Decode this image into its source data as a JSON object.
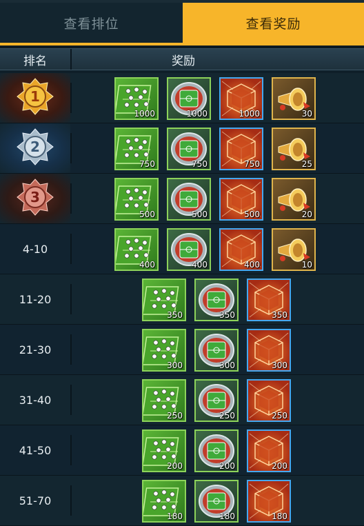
{
  "tabs": {
    "rank_tab": "查看排位",
    "reward_tab": "查看奖励"
  },
  "header": {
    "rank": "排名",
    "reward": "奖励"
  },
  "rows": [
    {
      "rank": "1",
      "rewards": [
        {
          "type": "tactic",
          "qty": "1000"
        },
        {
          "type": "stadium",
          "qty": "1000"
        },
        {
          "type": "cube",
          "qty": "1000"
        },
        {
          "type": "horn",
          "qty": "30"
        }
      ]
    },
    {
      "rank": "2",
      "rewards": [
        {
          "type": "tactic",
          "qty": "750"
        },
        {
          "type": "stadium",
          "qty": "750"
        },
        {
          "type": "cube",
          "qty": "750"
        },
        {
          "type": "horn",
          "qty": "25"
        }
      ]
    },
    {
      "rank": "3",
      "rewards": [
        {
          "type": "tactic",
          "qty": "500"
        },
        {
          "type": "stadium",
          "qty": "500"
        },
        {
          "type": "cube",
          "qty": "500"
        },
        {
          "type": "horn",
          "qty": "20"
        }
      ]
    },
    {
      "rank": "4-10",
      "rewards": [
        {
          "type": "tactic",
          "qty": "400"
        },
        {
          "type": "stadium",
          "qty": "400"
        },
        {
          "type": "cube",
          "qty": "400"
        },
        {
          "type": "horn",
          "qty": "10"
        }
      ]
    },
    {
      "rank": "11-20",
      "rewards": [
        {
          "type": "tactic",
          "qty": "350"
        },
        {
          "type": "stadium",
          "qty": "350"
        },
        {
          "type": "cube",
          "qty": "350"
        }
      ]
    },
    {
      "rank": "21-30",
      "rewards": [
        {
          "type": "tactic",
          "qty": "300"
        },
        {
          "type": "stadium",
          "qty": "300"
        },
        {
          "type": "cube",
          "qty": "300"
        }
      ]
    },
    {
      "rank": "31-40",
      "rewards": [
        {
          "type": "tactic",
          "qty": "250"
        },
        {
          "type": "stadium",
          "qty": "250"
        },
        {
          "type": "cube",
          "qty": "250"
        }
      ]
    },
    {
      "rank": "41-50",
      "rewards": [
        {
          "type": "tactic",
          "qty": "200"
        },
        {
          "type": "stadium",
          "qty": "200"
        },
        {
          "type": "cube",
          "qty": "200"
        }
      ]
    },
    {
      "rank": "51-70",
      "rewards": [
        {
          "type": "tactic",
          "qty": "180"
        },
        {
          "type": "stadium",
          "qty": "180"
        },
        {
          "type": "cube",
          "qty": "180"
        }
      ]
    }
  ],
  "icons": {
    "tactic": "tactic-board-icon",
    "stadium": "stadium-icon",
    "cube": "orange-cube-icon",
    "horn": "gold-horn-icon",
    "medal1": "gold-medal-icon",
    "medal2": "silver-medal-icon",
    "medal3": "bronze-medal-icon"
  },
  "colors": {
    "accent": "#f7b52a",
    "background": "#0f1f29"
  }
}
